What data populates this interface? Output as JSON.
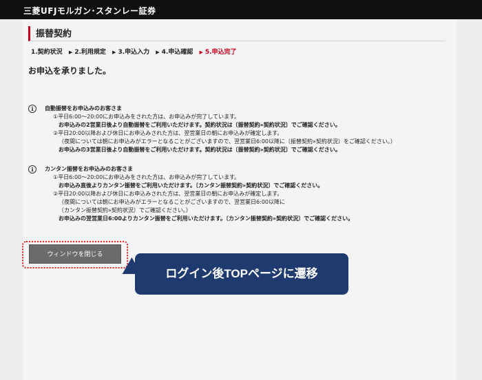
{
  "header": {
    "brand": "三菱UFJモルガン･スタンレー証券"
  },
  "page": {
    "title": "振替契約"
  },
  "steps": [
    {
      "label": "1.契約状況",
      "active": false
    },
    {
      "label": "2.利用規定",
      "active": false
    },
    {
      "label": "3.申込入力",
      "active": false
    },
    {
      "label": "4.申込確認",
      "active": false
    },
    {
      "label": "5.申込完了",
      "active": true
    }
  ],
  "message": "お申込を承りました。",
  "info_icon": "i",
  "auto": {
    "title": "自動振替をお申込みのお客さま",
    "lines": [
      "①平日6:00～20:00にお申込みをされた方は、お申込みが完了しています。",
      "お申込みの2営業日後より自動振替をご利用いただけます。契約状況は〔振替契約»契約状況〕でご確認ください。",
      "②平日20:00以降および休日にお申込みされた方は、翌営業日の朝にお申込みが確定します。",
      "（夜間については朝にお申込みがエラーとなることがございますので、翌営業日6:00以降に〔振替契約»契約状況〕をご確認ください。）",
      "お申込みの3営業日後より自動振替をご利用いただけます。契約状況は〔振替契約»契約状況〕でご確認ください。"
    ]
  },
  "kantan": {
    "title": "カンタン振替をお申込みのお客さま",
    "lines": [
      "①平日6:00～20:00にお申込みをされた方は、お申込みが完了しています。",
      "お申込み直後よりカンタン振替をご利用いただけます。〔カンタン振替契約»契約状況〕でご確認ください。",
      "②平日20:00以降および休日にお申込みされた方は、翌営業日の朝にお申込みが確定します。",
      "（夜間については朝にお申込みがエラーとなることがございますので、翌営業日6:00以降に",
      "〔カンタン振替契約»契約状況〕でご確認ください。）",
      "お申込みの翌営業日6:00よりカンタン振替をご利用いただけます。〔カンタン振替契約»契約状況〕でご確認ください。"
    ]
  },
  "close_button": "ウィンドウを閉じる",
  "callout": "ログイン後TOPページに遷移"
}
